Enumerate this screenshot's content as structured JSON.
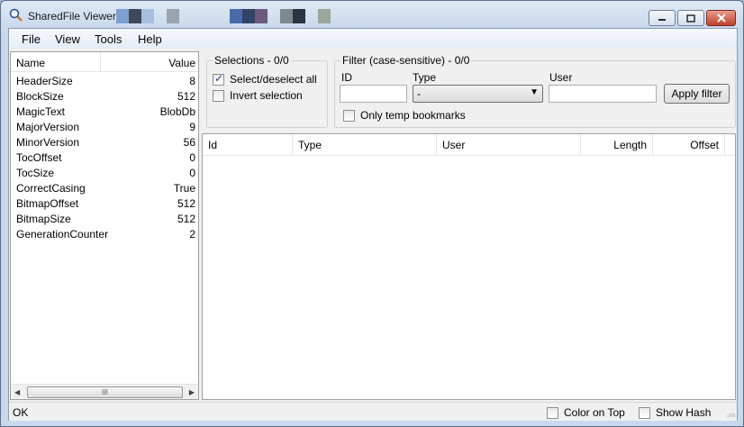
{
  "window": {
    "title": "SharedFile Viewer:",
    "redaction_colors": [
      "#7f9fd0",
      "#3d4a5c",
      "#a9bfe0",
      "#9aa3ae",
      "#4a6aa8",
      "#2f4466",
      "#6e5a7e",
      "#7a8a8e",
      "#2b3340",
      "#9aa69c"
    ]
  },
  "menu": {
    "items": [
      "File",
      "View",
      "Tools",
      "Help"
    ]
  },
  "properties": {
    "header_name": "Name",
    "header_value": "Value",
    "rows": [
      {
        "name": "HeaderSize",
        "value": "8"
      },
      {
        "name": "BlockSize",
        "value": "512"
      },
      {
        "name": "MagicText",
        "value": "BlobDb"
      },
      {
        "name": "MajorVersion",
        "value": "9"
      },
      {
        "name": "MinorVersion",
        "value": "56"
      },
      {
        "name": "TocOffset",
        "value": "0"
      },
      {
        "name": "TocSize",
        "value": "0"
      },
      {
        "name": "CorrectCasing",
        "value": "True"
      },
      {
        "name": "BitmapOffset",
        "value": "512"
      },
      {
        "name": "BitmapSize",
        "value": "512"
      },
      {
        "name": "GenerationCounter",
        "value": "2"
      }
    ],
    "scroll_thumb": "III"
  },
  "selections": {
    "title": "Selections - 0/0",
    "select_all_label": "Select/deselect all",
    "select_all_checked": true,
    "invert_label": "Invert selection",
    "invert_checked": false
  },
  "filter": {
    "title": "Filter (case-sensitive) - 0/0",
    "id_label": "ID",
    "id_value": "",
    "type_label": "Type",
    "type_value": "-",
    "user_label": "User",
    "user_value": "",
    "apply_label": "Apply filter",
    "temp_label": "Only temp bookmarks",
    "temp_checked": false
  },
  "list": {
    "columns": [
      "Id",
      "Type",
      "User",
      "Length",
      "Offset"
    ]
  },
  "status": {
    "text": "OK",
    "color_on_top_label": "Color on Top",
    "color_on_top_checked": false,
    "show_hash_label": "Show Hash",
    "show_hash_checked": false
  }
}
